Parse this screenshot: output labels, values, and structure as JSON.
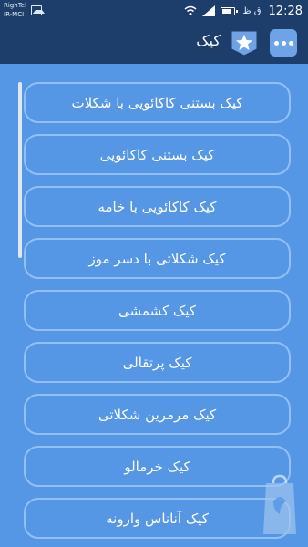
{
  "status_bar": {
    "carrier_line1": "RighTel",
    "carrier_line2": "IR-MCI",
    "indicators": "ق ظ",
    "time": "12:28"
  },
  "header": {
    "title": "کیک"
  },
  "recipes": [
    {
      "label": "کیک بستنی کاکائویی با شکلات"
    },
    {
      "label": "کیک بستنی کاکائویی"
    },
    {
      "label": "کیک کاکائویی با خامه"
    },
    {
      "label": "کیک شکلاتی با دسر موز"
    },
    {
      "label": "کیک کشمشی"
    },
    {
      "label": "کیک پرتقالی"
    },
    {
      "label": "کیک مرمرین شکلاتی"
    },
    {
      "label": "کیک خرمالو"
    },
    {
      "label": "کیک آناناس وارونه"
    }
  ],
  "colors": {
    "background": "#5596e5",
    "app_bar": "#1d3d6a",
    "item_border": "#92c0f3",
    "accent_button": "#6fa3e8"
  },
  "icons": {
    "menu": "more-dots-icon",
    "favorite": "star-icon",
    "watermark": "shopping-bag-logo"
  }
}
